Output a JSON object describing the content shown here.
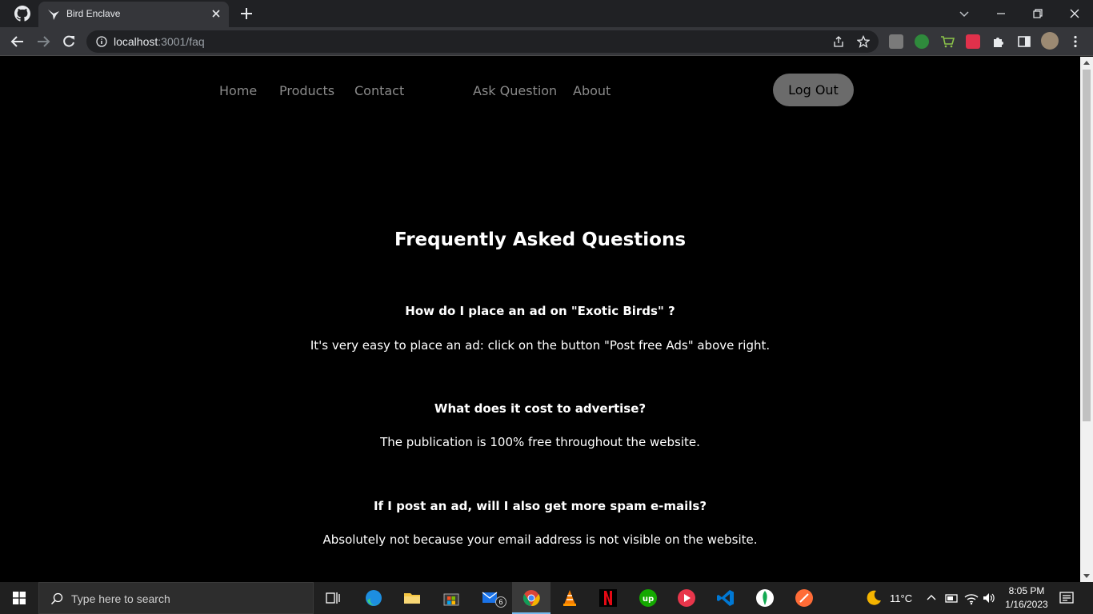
{
  "browser": {
    "tab_title": "Bird Enclave",
    "url_host": "localhost",
    "url_path": ":3001/faq"
  },
  "nav": {
    "home": "Home",
    "products": "Products",
    "contact": "Contact",
    "ask_question": "Ask Question",
    "about": "About",
    "logout": "Log Out"
  },
  "faq": {
    "title": "Frequently Asked Questions",
    "items": [
      {
        "question": "How do I place an ad on \"Exotic Birds\" ?",
        "answer": "It's very easy to place an ad: click on the button \"Post free Ads\" above right."
      },
      {
        "question": "What does it cost to advertise?",
        "answer": "The publication is 100% free throughout the website."
      },
      {
        "question": "If I post an ad, will I also get more spam e-mails?",
        "answer": "Absolutely not because your email address is not visible on the website."
      }
    ]
  },
  "taskbar": {
    "search_placeholder": "Type here to search",
    "mail_badge": "6",
    "weather": "11°C",
    "time": "8:05 PM",
    "date": "1/16/2023"
  },
  "colors": {
    "page_bg": "#000000",
    "nav_text": "#8a8a8a",
    "logout_bg": "#6b6b6b",
    "chrome_dark": "#202124",
    "chrome_tab": "#35363a"
  }
}
